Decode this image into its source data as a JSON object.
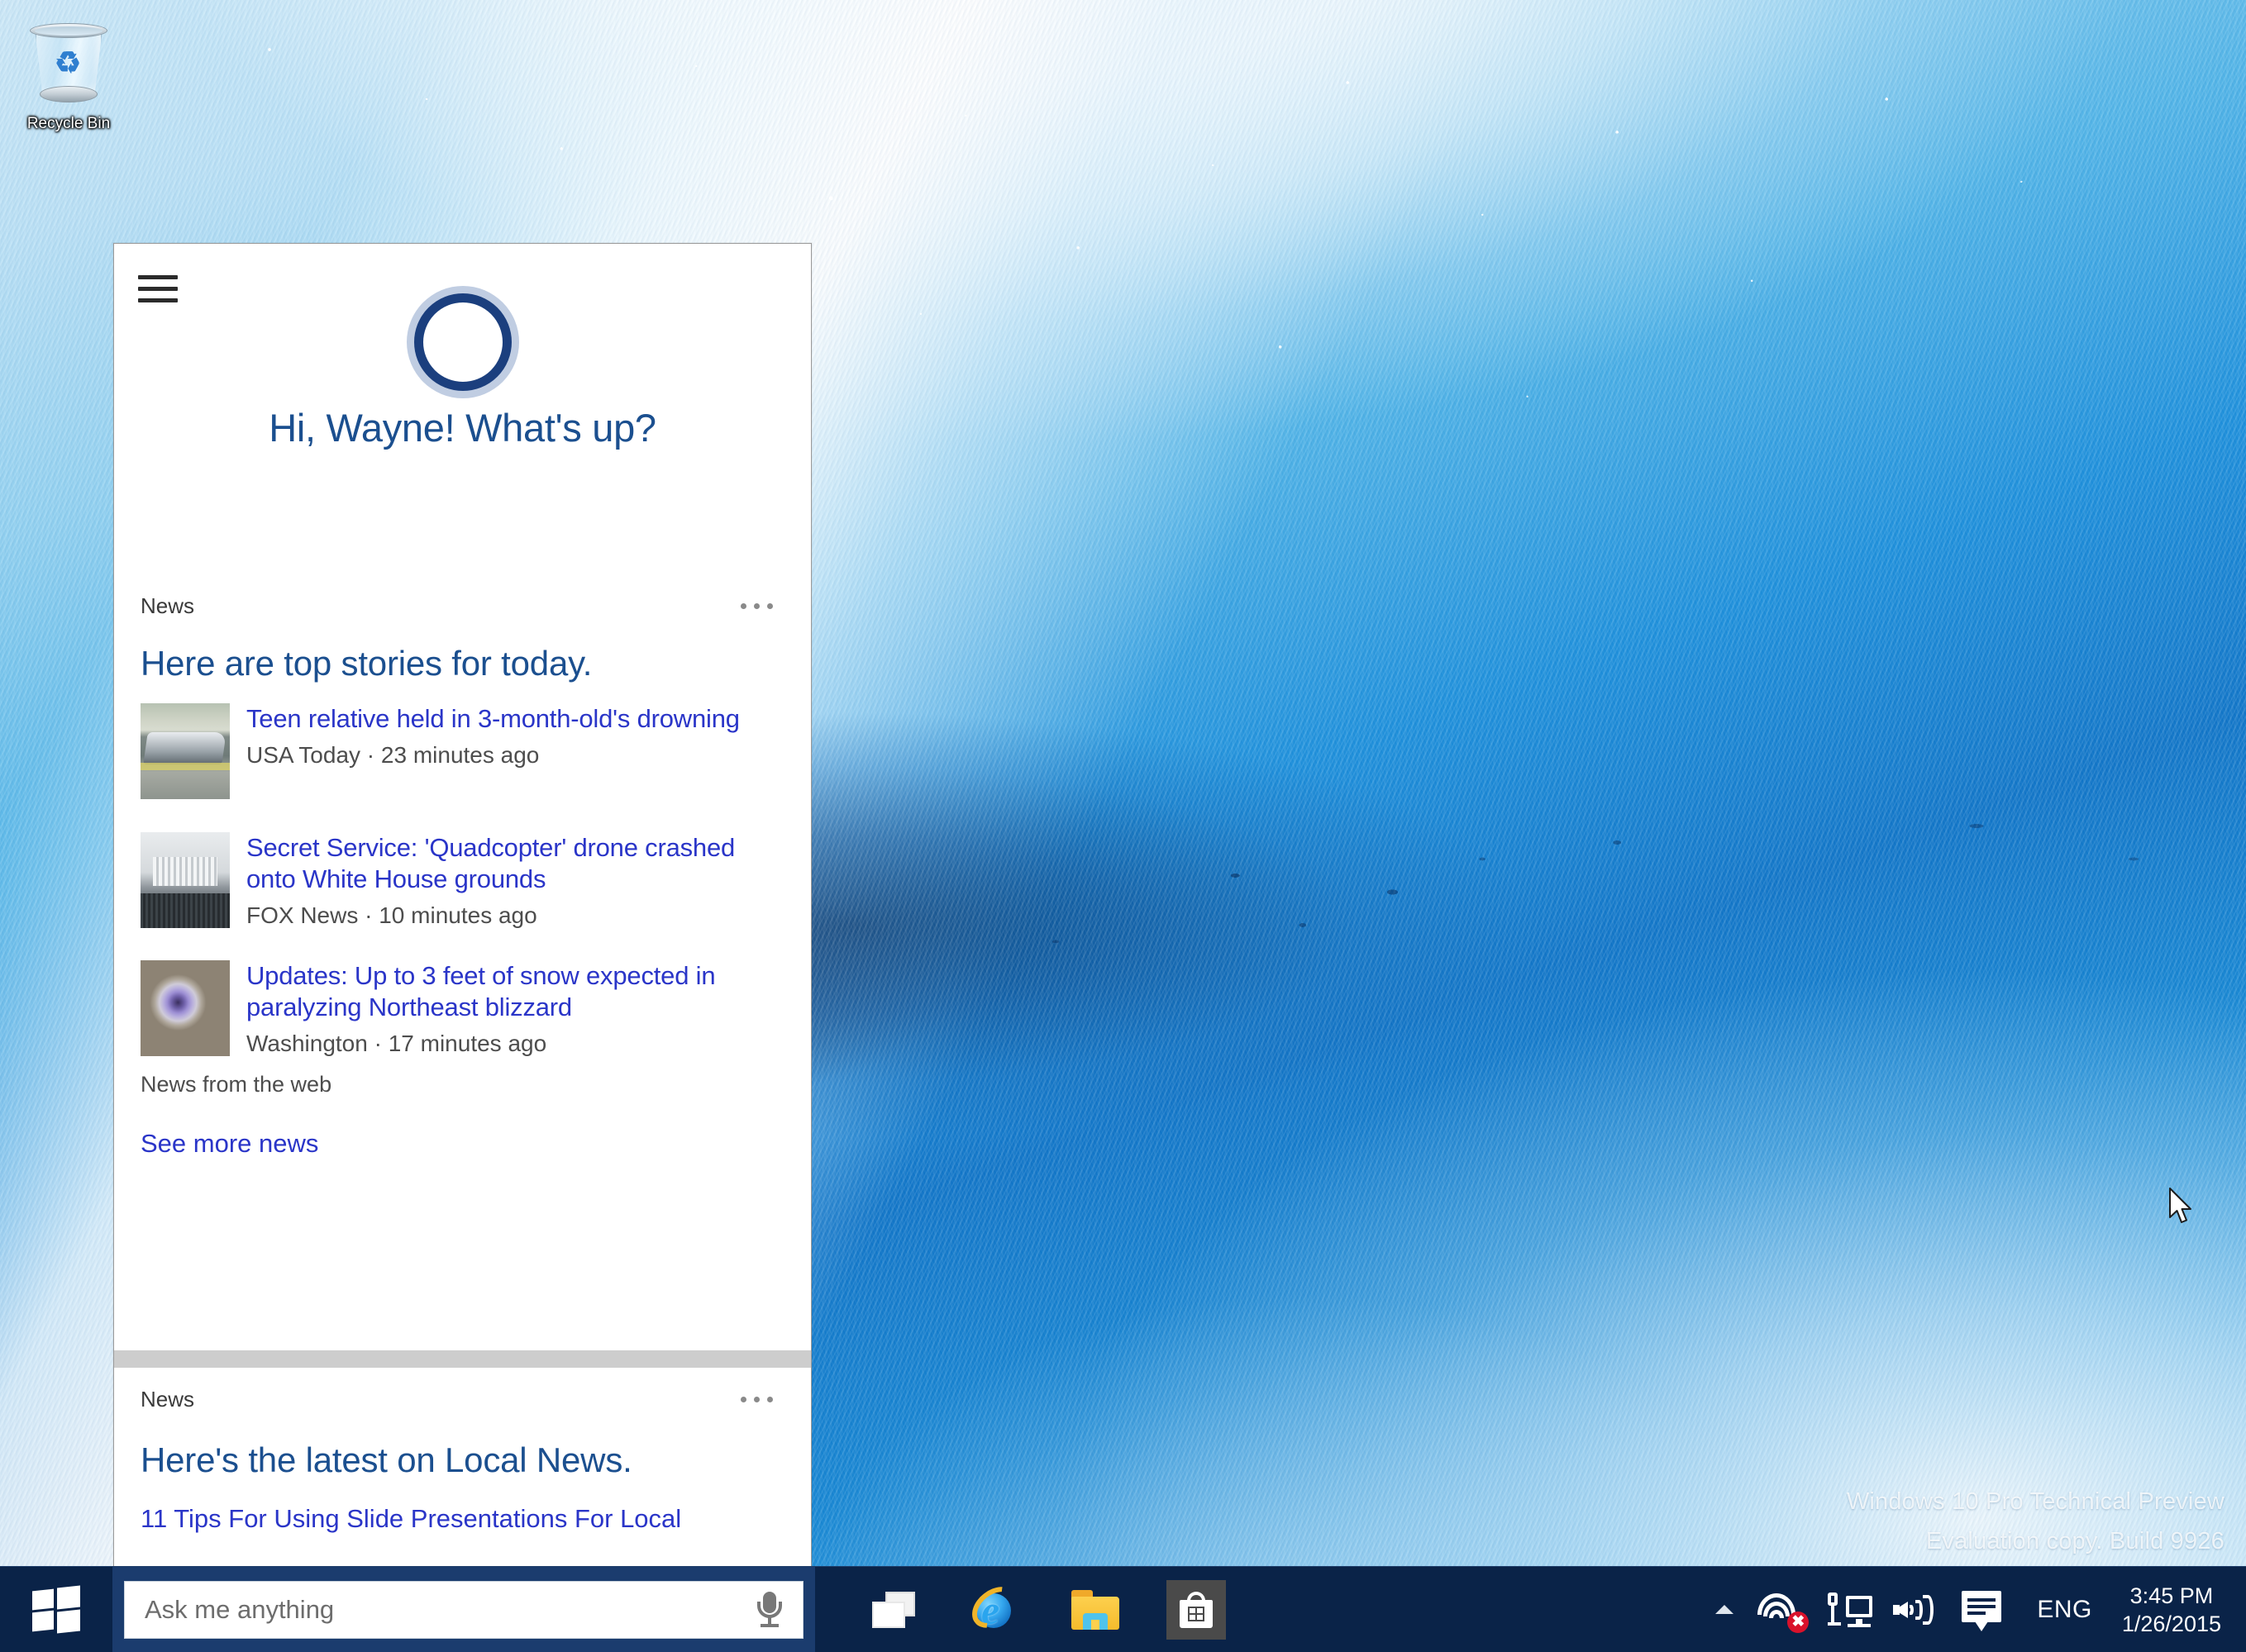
{
  "desktop": {
    "icons": [
      {
        "name": "Recycle Bin"
      }
    ],
    "watermark": {
      "line1": "Windows 10 Pro Technical Preview",
      "line2": "Evaluation copy. Build 9926"
    }
  },
  "cortana": {
    "menu_icon": "hamburger-icon",
    "logo_icon": "cortana-ring-icon",
    "greeting": "Hi, Wayne! What's up?",
    "cards": [
      {
        "source": "News",
        "more_label": "•••",
        "title": "Here are top stories for today.",
        "stories": [
          {
            "headline": "Teen relative held in 3-month-old's drowning",
            "meta": "USA Today · 23 minutes ago",
            "thumb": "street-scene-thumbnail"
          },
          {
            "headline": "Secret Service: 'Quadcopter' drone crashed onto White House grounds",
            "meta": "FOX News · 10 minutes ago",
            "thumb": "white-house-thumbnail"
          },
          {
            "headline": "Updates: Up to 3 feet of snow expected in paralyzing Northeast blizzard",
            "meta": "Washington · 17 minutes ago",
            "thumb": "storm-satellite-thumbnail"
          }
        ],
        "attribution": "News from the web",
        "see_more": "See more news"
      },
      {
        "source": "News",
        "more_label": "•••",
        "title": "Here's the latest on Local News.",
        "clipped_headline": "11 Tips For Using Slide Presentations For Local"
      }
    ]
  },
  "taskbar": {
    "start_icon": "windows-logo-icon",
    "search": {
      "placeholder": "Ask me anything",
      "value": "",
      "mic_icon": "microphone-icon"
    },
    "buttons": [
      {
        "label": "Task View",
        "icon": "task-view-icon"
      },
      {
        "label": "Internet Explorer",
        "icon": "internet-explorer-icon"
      },
      {
        "label": "File Explorer",
        "icon": "file-explorer-icon"
      },
      {
        "label": "Store",
        "icon": "store-bag-icon"
      }
    ],
    "tray": {
      "overflow_icon": "chevron-up-icon",
      "network_status_icon": "network-error-icon",
      "ethernet_icon": "ethernet-icon",
      "volume_icon": "volume-icon",
      "action_center_icon": "action-center-icon",
      "language": "ENG",
      "time": "3:45 PM",
      "date": "1/26/2015"
    }
  },
  "colors": {
    "taskbar_bg": "#0a2348",
    "search_bg": "#1b3c6e",
    "cortana_accent": "#1b3f7e",
    "headline_link": "#2a35c8",
    "card_title": "#1b4f8f",
    "error_badge": "#d9122b"
  }
}
